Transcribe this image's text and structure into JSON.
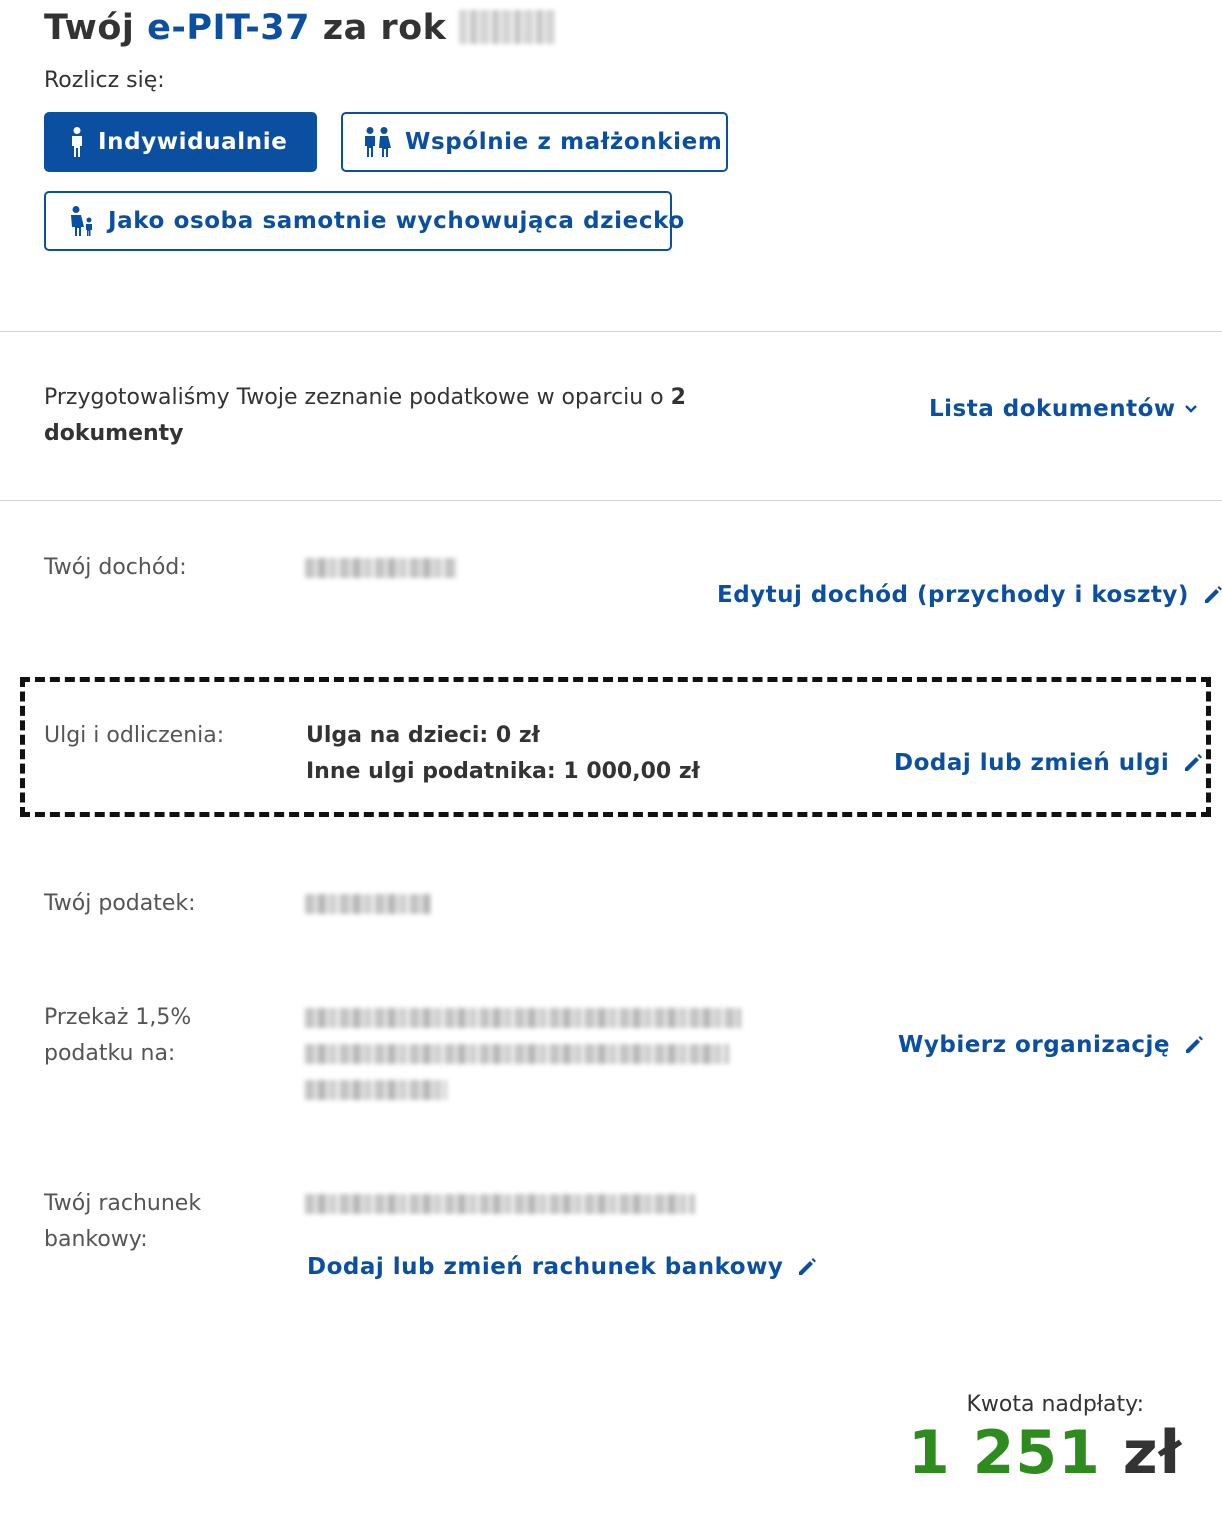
{
  "header": {
    "title_prefix": "Twój ",
    "title_e": "e-PIT-",
    "title_number": "37",
    "title_suffix": " za rok ",
    "subtitle": "Rozlicz się:"
  },
  "settlement_options": {
    "individual": "Indywidualnie",
    "spouse": "Wspólnie z małżonkiem",
    "single_parent": "Jako osoba samotnie wychowująca dziecko"
  },
  "documents": {
    "text": "Przygotowaliśmy Twoje zeznanie podatkowe w oparciu o ",
    "count": "2",
    "unit": "dokumenty",
    "list_link": "Lista dokumentów"
  },
  "income": {
    "label": "Twój dochód:",
    "edit_link": "Edytuj dochód (przychody i koszty)"
  },
  "reliefs": {
    "label": "Ulgi i odliczenia:",
    "children_relief": "Ulga na dzieci: 0 zł",
    "other_reliefs": "Inne ulgi podatnika: 1 000,00 zł",
    "edit_link": "Dodaj lub zmień ulgi"
  },
  "tax": {
    "label": "Twój podatek:"
  },
  "donation": {
    "label_line1": "Przekaż 1,5%",
    "label_line2": "podatku na:",
    "edit_link": "Wybierz organizację"
  },
  "bank": {
    "label_line1": "Twój rachunek",
    "label_line2": "bankowy:",
    "edit_link": "Dodaj lub zmień rachunek bankowy"
  },
  "refund": {
    "label": "Kwota nadpłaty:",
    "amount": "1 251",
    "currency": " zł"
  },
  "colors": {
    "primary": "#0b4fa0",
    "refund_green": "#2e8b1e"
  },
  "icons": {
    "individual": "person-icon",
    "spouse": "couple-icon",
    "single_parent": "parent-child-icon",
    "list": "chevron-down-icon",
    "edit": "pencil-icon"
  }
}
